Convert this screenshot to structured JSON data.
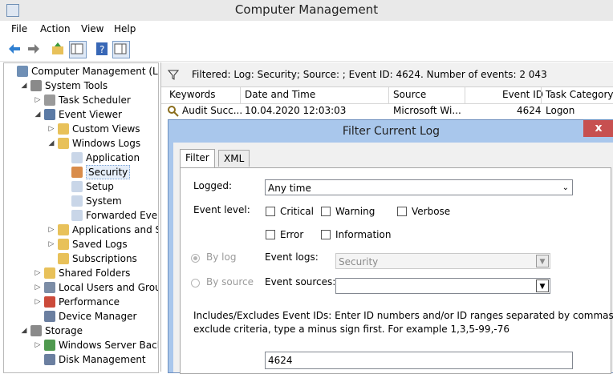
{
  "window": {
    "title": "Computer Management"
  },
  "menu": [
    "File",
    "Action",
    "View",
    "Help"
  ],
  "tree": [
    {
      "label": "Computer Management (Local",
      "depth": 0,
      "toggle": "",
      "icon": "computer-icon",
      "color": "#6f8fb5"
    },
    {
      "label": "System Tools",
      "depth": 1,
      "toggle": "◢",
      "icon": "tools-icon",
      "color": "#8a8a8a"
    },
    {
      "label": "Task Scheduler",
      "depth": 2,
      "toggle": "▷",
      "icon": "clock-icon",
      "color": "#9a9a9a"
    },
    {
      "label": "Event Viewer",
      "depth": 2,
      "toggle": "◢",
      "icon": "event-viewer-icon",
      "color": "#5b7aa5"
    },
    {
      "label": "Custom Views",
      "depth": 3,
      "toggle": "▷",
      "icon": "folder-icon",
      "color": "#e8c15a"
    },
    {
      "label": "Windows Logs",
      "depth": 3,
      "toggle": "◢",
      "icon": "folder-icon",
      "color": "#e8c15a"
    },
    {
      "label": "Application",
      "depth": 4,
      "toggle": "",
      "icon": "log-icon",
      "color": "#c9d6e8"
    },
    {
      "label": "Security",
      "depth": 4,
      "toggle": "",
      "icon": "log-icon",
      "color": "#d98c4a",
      "selected": true
    },
    {
      "label": "Setup",
      "depth": 4,
      "toggle": "",
      "icon": "log-icon",
      "color": "#c9d6e8"
    },
    {
      "label": "System",
      "depth": 4,
      "toggle": "",
      "icon": "log-icon",
      "color": "#c9d6e8"
    },
    {
      "label": "Forwarded Event",
      "depth": 4,
      "toggle": "",
      "icon": "log-icon",
      "color": "#c9d6e8"
    },
    {
      "label": "Applications and Se",
      "depth": 3,
      "toggle": "▷",
      "icon": "folder-icon",
      "color": "#e8c15a"
    },
    {
      "label": "Saved Logs",
      "depth": 3,
      "toggle": "▷",
      "icon": "folder-icon",
      "color": "#e8c15a"
    },
    {
      "label": "Subscriptions",
      "depth": 3,
      "toggle": "",
      "icon": "subscriptions-icon",
      "color": "#e8c15a"
    },
    {
      "label": "Shared Folders",
      "depth": 2,
      "toggle": "▷",
      "icon": "shared-folder-icon",
      "color": "#e8c15a"
    },
    {
      "label": "Local Users and Groups",
      "depth": 2,
      "toggle": "▷",
      "icon": "users-icon",
      "color": "#7c8da6"
    },
    {
      "label": "Performance",
      "depth": 2,
      "toggle": "▷",
      "icon": "performance-icon",
      "color": "#cc4a3a"
    },
    {
      "label": "Device Manager",
      "depth": 2,
      "toggle": "",
      "icon": "device-manager-icon",
      "color": "#6b7fa0"
    },
    {
      "label": "Storage",
      "depth": 1,
      "toggle": "◢",
      "icon": "storage-icon",
      "color": "#8a8a8a"
    },
    {
      "label": "Windows Server Backup",
      "depth": 2,
      "toggle": "▷",
      "icon": "backup-icon",
      "color": "#4f9a4f"
    },
    {
      "label": "Disk Management",
      "depth": 2,
      "toggle": "",
      "icon": "disk-icon",
      "color": "#6b7fa0"
    }
  ],
  "filter_info": "Filtered: Log: Security; Source: ; Event ID: 4624. Number of events: 2 043",
  "columns": [
    "Keywords",
    "Date and Time",
    "Source",
    "Event ID",
    "Task Category"
  ],
  "event_row": {
    "keywords": "Audit Succ...",
    "date": "10.04.2020 12:03:03",
    "source": "Microsoft Wi...",
    "event_id": "4624",
    "task_category": "Logon"
  },
  "dialog": {
    "title": "Filter Current Log",
    "close_label": "x",
    "tabs": [
      "Filter",
      "XML"
    ],
    "logged_label": "Logged:",
    "logged_value": "Any time",
    "event_level_label": "Event level:",
    "levels": [
      {
        "label": "Critical",
        "checked": false
      },
      {
        "label": "Warning",
        "checked": false
      },
      {
        "label": "Verbose",
        "checked": false
      },
      {
        "label": "Error",
        "checked": false
      },
      {
        "label": "Information",
        "checked": false
      }
    ],
    "by_log_label": "By log",
    "by_source_label": "By source",
    "event_logs_label": "Event logs:",
    "event_logs_value": "Security",
    "event_sources_label": "Event sources:",
    "event_sources_value": "",
    "help_text_1": "Includes/Excludes Event IDs: Enter ID numbers and/or ID ranges separated by commas. To",
    "help_text_2": "exclude criteria, type a minus sign first. For example 1,3,5-99,-76",
    "event_ids_value": "4624"
  }
}
